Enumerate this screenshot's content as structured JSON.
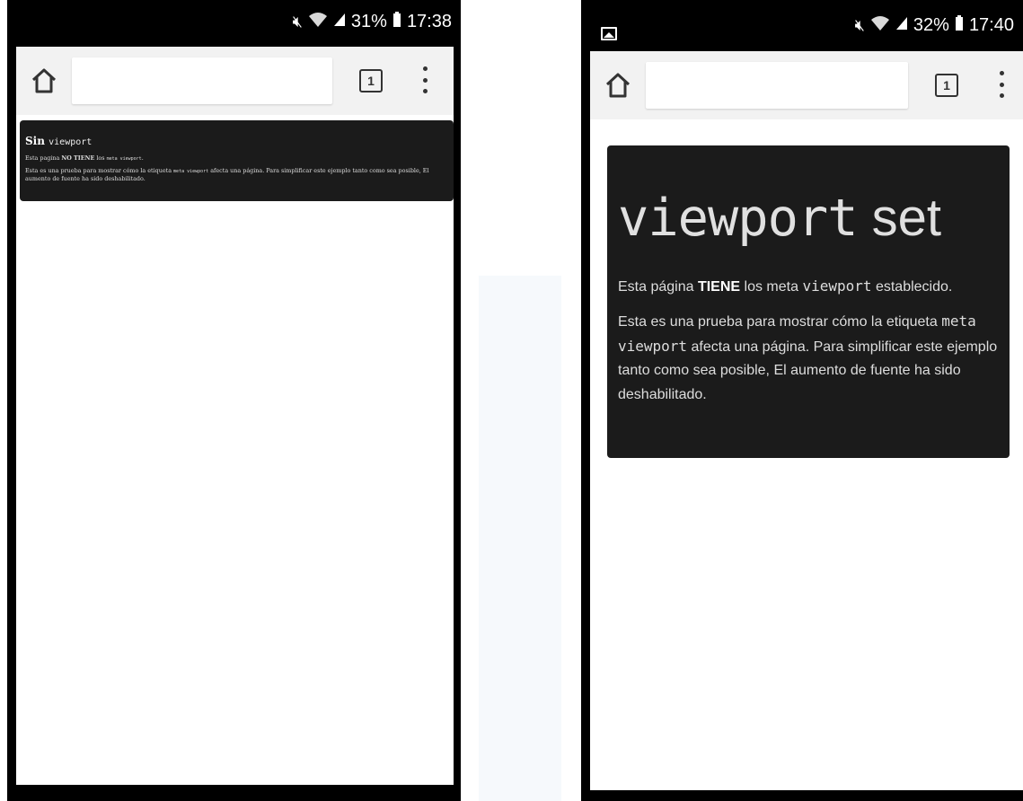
{
  "left_phone": {
    "status": {
      "battery": "31%",
      "time": "17:38"
    },
    "toolbar": {
      "tab_count": "1"
    },
    "card": {
      "heading_word": "Sin",
      "heading_code": "viewport",
      "p1_before": "Esta pagina ",
      "p1_bold": "NO TIENE",
      "p1_mid": " los ",
      "p1_code": "meta viewport",
      "p1_after": ".",
      "p2_before": "Esta es una prueba para mostrar cómo la etiqueta ",
      "p2_code": "meta viewport",
      "p2_after": " afecta una página. Para simplificar este ejemplo tanto como sea posible, El aumento de fuente ha sido deshabilitado."
    }
  },
  "right_phone": {
    "status": {
      "battery": "32%",
      "time": "17:40"
    },
    "toolbar": {
      "tab_count": "1"
    },
    "card": {
      "heading_code": "viewport",
      "heading_suffix": " set",
      "p1_before": "Esta página ",
      "p1_bold": "TIENE",
      "p1_mid": " los meta ",
      "p1_code": "viewport",
      "p1_after": " establecido.",
      "p2_before": "Esta es una prueba para mostrar cómo la etiqueta ",
      "p2_code": "meta viewport",
      "p2_after": " afecta una página. Para simplificar este ejemplo tanto como sea posible, El aumento de fuente ha sido deshabilitado."
    }
  },
  "icons": {
    "mute": "mute-icon",
    "wifi": "wifi-icon",
    "signal": "signal-icon",
    "battery": "battery-icon",
    "home": "home-icon",
    "tabs": "tab-switcher-icon",
    "menu": "overflow-menu-icon",
    "gallery": "gallery-notification-icon"
  }
}
